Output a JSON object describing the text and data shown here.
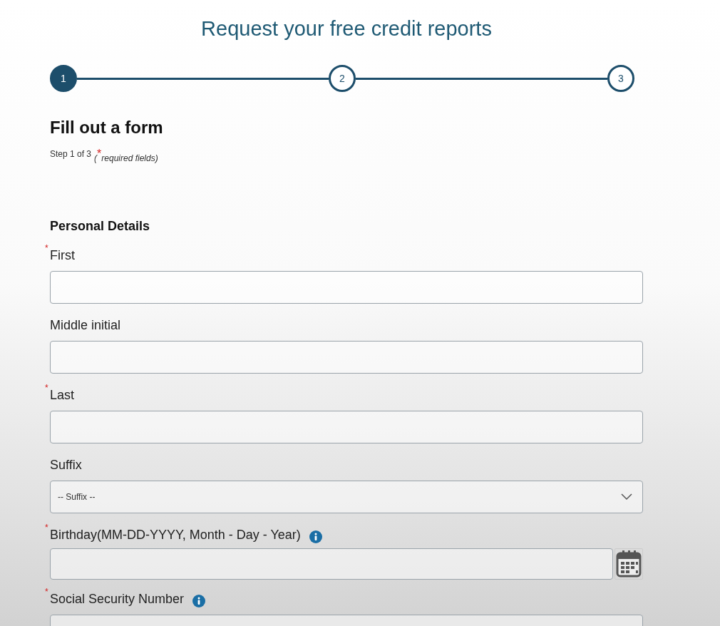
{
  "title": "Request your free credit reports",
  "steps": [
    {
      "label": "1",
      "selected": true
    },
    {
      "label": "2",
      "selected": false
    },
    {
      "label": "3",
      "selected": false
    }
  ],
  "heading": "Fill out a form",
  "step_info": {
    "text": "Step 1 of 3",
    "open": "(",
    "mark": "*",
    "legend": "required fields)"
  },
  "section": "Personal Details",
  "required_marker": "*",
  "fields": [
    {
      "kind": "text",
      "label": "First",
      "required": true,
      "info": false
    },
    {
      "kind": "text",
      "label": "Middle initial",
      "required": false,
      "info": false
    },
    {
      "kind": "text",
      "label": "Last",
      "required": true,
      "info": false
    },
    {
      "kind": "select",
      "label": "Suffix",
      "required": false,
      "info": false,
      "value": "-- Suffix --"
    },
    {
      "kind": "date",
      "label": "Birthday(MM-DD-YYYY, Month - Day - Year)",
      "required": true,
      "info": true
    },
    {
      "kind": "text",
      "label": "Social Security Number",
      "required": true,
      "info": true
    }
  ]
}
